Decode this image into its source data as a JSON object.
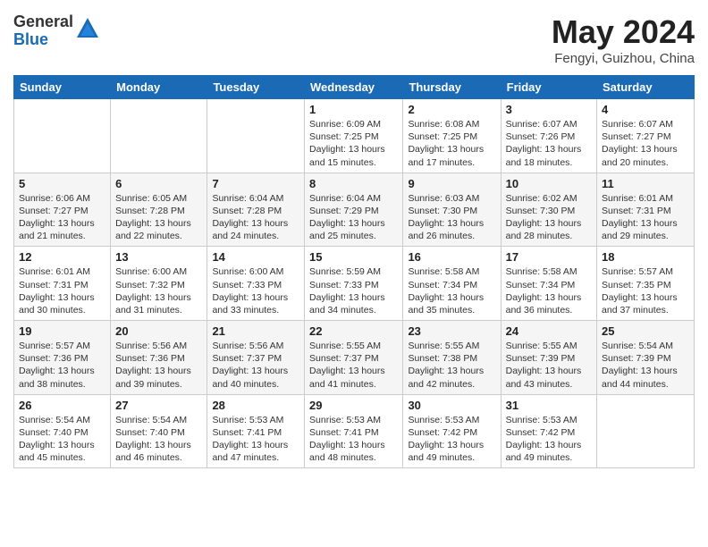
{
  "header": {
    "logo_general": "General",
    "logo_blue": "Blue",
    "month_year": "May 2024",
    "location": "Fengyi, Guizhou, China"
  },
  "days_of_week": [
    "Sunday",
    "Monday",
    "Tuesday",
    "Wednesday",
    "Thursday",
    "Friday",
    "Saturday"
  ],
  "weeks": [
    [
      {
        "day": "",
        "info": ""
      },
      {
        "day": "",
        "info": ""
      },
      {
        "day": "",
        "info": ""
      },
      {
        "day": "1",
        "info": "Sunrise: 6:09 AM\nSunset: 7:25 PM\nDaylight: 13 hours and 15 minutes."
      },
      {
        "day": "2",
        "info": "Sunrise: 6:08 AM\nSunset: 7:25 PM\nDaylight: 13 hours and 17 minutes."
      },
      {
        "day": "3",
        "info": "Sunrise: 6:07 AM\nSunset: 7:26 PM\nDaylight: 13 hours and 18 minutes."
      },
      {
        "day": "4",
        "info": "Sunrise: 6:07 AM\nSunset: 7:27 PM\nDaylight: 13 hours and 20 minutes."
      }
    ],
    [
      {
        "day": "5",
        "info": "Sunrise: 6:06 AM\nSunset: 7:27 PM\nDaylight: 13 hours and 21 minutes."
      },
      {
        "day": "6",
        "info": "Sunrise: 6:05 AM\nSunset: 7:28 PM\nDaylight: 13 hours and 22 minutes."
      },
      {
        "day": "7",
        "info": "Sunrise: 6:04 AM\nSunset: 7:28 PM\nDaylight: 13 hours and 24 minutes."
      },
      {
        "day": "8",
        "info": "Sunrise: 6:04 AM\nSunset: 7:29 PM\nDaylight: 13 hours and 25 minutes."
      },
      {
        "day": "9",
        "info": "Sunrise: 6:03 AM\nSunset: 7:30 PM\nDaylight: 13 hours and 26 minutes."
      },
      {
        "day": "10",
        "info": "Sunrise: 6:02 AM\nSunset: 7:30 PM\nDaylight: 13 hours and 28 minutes."
      },
      {
        "day": "11",
        "info": "Sunrise: 6:01 AM\nSunset: 7:31 PM\nDaylight: 13 hours and 29 minutes."
      }
    ],
    [
      {
        "day": "12",
        "info": "Sunrise: 6:01 AM\nSunset: 7:31 PM\nDaylight: 13 hours and 30 minutes."
      },
      {
        "day": "13",
        "info": "Sunrise: 6:00 AM\nSunset: 7:32 PM\nDaylight: 13 hours and 31 minutes."
      },
      {
        "day": "14",
        "info": "Sunrise: 6:00 AM\nSunset: 7:33 PM\nDaylight: 13 hours and 33 minutes."
      },
      {
        "day": "15",
        "info": "Sunrise: 5:59 AM\nSunset: 7:33 PM\nDaylight: 13 hours and 34 minutes."
      },
      {
        "day": "16",
        "info": "Sunrise: 5:58 AM\nSunset: 7:34 PM\nDaylight: 13 hours and 35 minutes."
      },
      {
        "day": "17",
        "info": "Sunrise: 5:58 AM\nSunset: 7:34 PM\nDaylight: 13 hours and 36 minutes."
      },
      {
        "day": "18",
        "info": "Sunrise: 5:57 AM\nSunset: 7:35 PM\nDaylight: 13 hours and 37 minutes."
      }
    ],
    [
      {
        "day": "19",
        "info": "Sunrise: 5:57 AM\nSunset: 7:36 PM\nDaylight: 13 hours and 38 minutes."
      },
      {
        "day": "20",
        "info": "Sunrise: 5:56 AM\nSunset: 7:36 PM\nDaylight: 13 hours and 39 minutes."
      },
      {
        "day": "21",
        "info": "Sunrise: 5:56 AM\nSunset: 7:37 PM\nDaylight: 13 hours and 40 minutes."
      },
      {
        "day": "22",
        "info": "Sunrise: 5:55 AM\nSunset: 7:37 PM\nDaylight: 13 hours and 41 minutes."
      },
      {
        "day": "23",
        "info": "Sunrise: 5:55 AM\nSunset: 7:38 PM\nDaylight: 13 hours and 42 minutes."
      },
      {
        "day": "24",
        "info": "Sunrise: 5:55 AM\nSunset: 7:39 PM\nDaylight: 13 hours and 43 minutes."
      },
      {
        "day": "25",
        "info": "Sunrise: 5:54 AM\nSunset: 7:39 PM\nDaylight: 13 hours and 44 minutes."
      }
    ],
    [
      {
        "day": "26",
        "info": "Sunrise: 5:54 AM\nSunset: 7:40 PM\nDaylight: 13 hours and 45 minutes."
      },
      {
        "day": "27",
        "info": "Sunrise: 5:54 AM\nSunset: 7:40 PM\nDaylight: 13 hours and 46 minutes."
      },
      {
        "day": "28",
        "info": "Sunrise: 5:53 AM\nSunset: 7:41 PM\nDaylight: 13 hours and 47 minutes."
      },
      {
        "day": "29",
        "info": "Sunrise: 5:53 AM\nSunset: 7:41 PM\nDaylight: 13 hours and 48 minutes."
      },
      {
        "day": "30",
        "info": "Sunrise: 5:53 AM\nSunset: 7:42 PM\nDaylight: 13 hours and 49 minutes."
      },
      {
        "day": "31",
        "info": "Sunrise: 5:53 AM\nSunset: 7:42 PM\nDaylight: 13 hours and 49 minutes."
      },
      {
        "day": "",
        "info": ""
      }
    ]
  ]
}
